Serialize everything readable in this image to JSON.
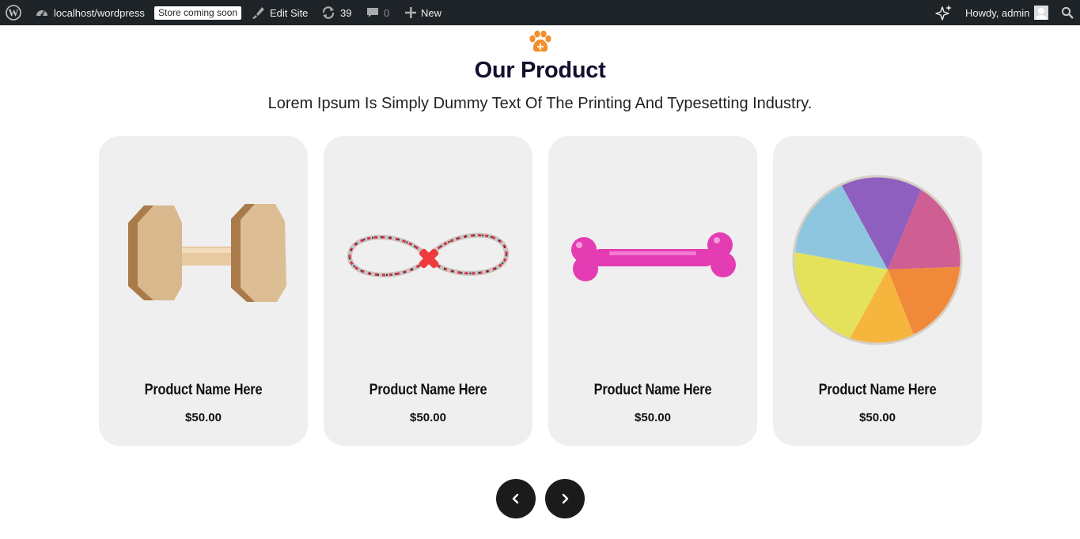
{
  "admin_bar": {
    "site_url": "localhost/wordpress",
    "store_badge": "Store coming soon",
    "edit_site": "Edit Site",
    "updates_count": "39",
    "comments_count": "0",
    "new_label": "New",
    "greeting": "Howdy, admin"
  },
  "section": {
    "title": "Our Product",
    "subtitle": "Lorem Ipsum Is Simply Dummy Text Of The Printing And Typesetting Industry.",
    "accent_color": "#f28e2b"
  },
  "products": [
    {
      "name": "Product Name Here",
      "price": "$50.00",
      "image": "wooden-dumbbell-toy"
    },
    {
      "name": "Product Name Here",
      "price": "$50.00",
      "image": "rope-toy"
    },
    {
      "name": "Product Name Here",
      "price": "$50.00",
      "image": "pink-bone-toy"
    },
    {
      "name": "Product Name Here",
      "price": "$50.00",
      "image": "plush-ball-toy"
    }
  ],
  "navigation": {
    "prev_icon": "chevron-left-icon",
    "next_icon": "chevron-right-icon"
  }
}
